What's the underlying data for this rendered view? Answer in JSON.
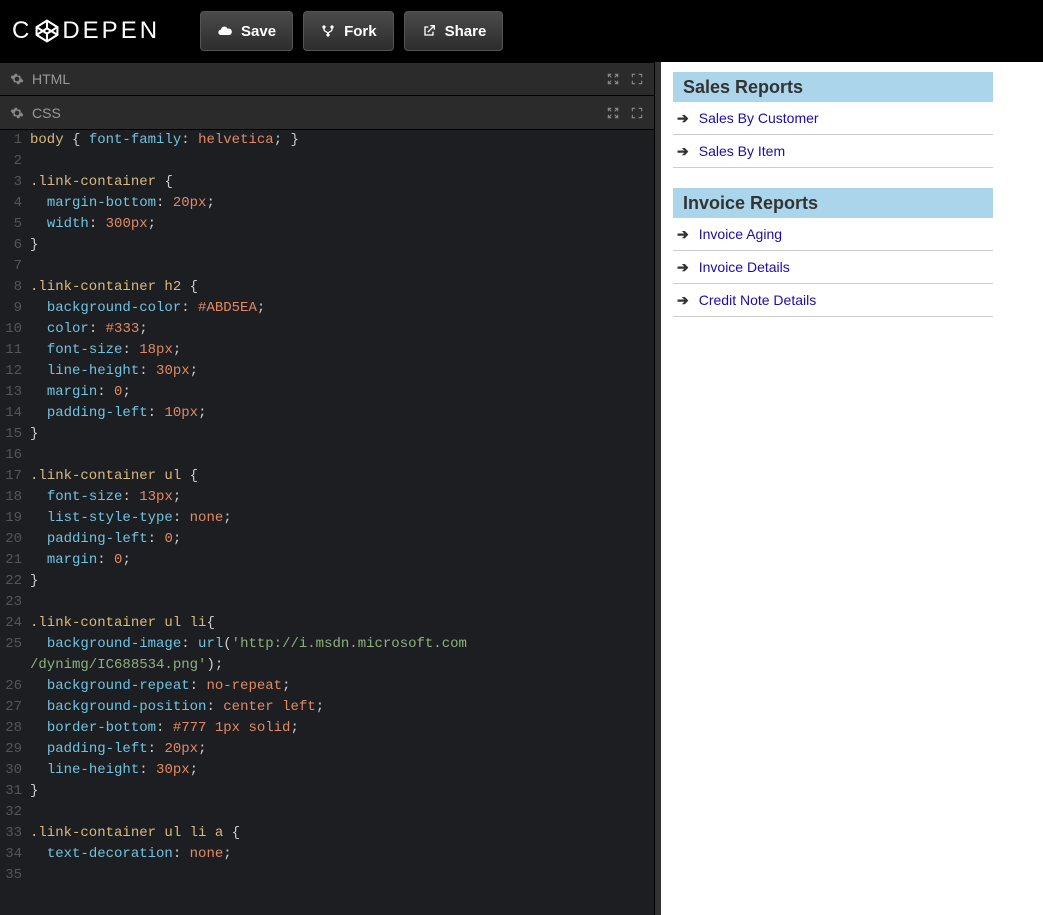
{
  "header": {
    "logo_text_left": "C",
    "logo_text_right": "DEPEN",
    "save_label": "Save",
    "fork_label": "Fork",
    "share_label": "Share"
  },
  "panels": {
    "html_label": "HTML",
    "css_label": "CSS"
  },
  "code_lines": [
    {
      "n": "1",
      "html": "<span class='tok-sel'>body</span> <span class='tok-punc'>{</span> <span class='tok-prop'>font-family</span><span class='tok-punc'>:</span> <span class='tok-val'>helvetica</span><span class='tok-punc'>;</span> <span class='tok-punc'>}</span>"
    },
    {
      "n": "2",
      "html": ""
    },
    {
      "n": "3",
      "html": "<span class='tok-sel'>.link-container</span> <span class='tok-punc'>{</span>"
    },
    {
      "n": "4",
      "html": "  <span class='tok-prop'>margin-bottom</span><span class='tok-punc'>:</span> <span class='tok-num'>20px</span><span class='tok-punc'>;</span>"
    },
    {
      "n": "5",
      "html": "  <span class='tok-prop'>width</span><span class='tok-punc'>:</span> <span class='tok-num'>300px</span><span class='tok-punc'>;</span>"
    },
    {
      "n": "6",
      "html": "<span class='tok-punc'>}</span>"
    },
    {
      "n": "7",
      "html": ""
    },
    {
      "n": "8",
      "html": "<span class='tok-sel'>.link-container h2</span> <span class='tok-punc'>{</span>"
    },
    {
      "n": "9",
      "html": "  <span class='tok-prop'>background-color</span><span class='tok-punc'>:</span> <span class='tok-val'>#ABD5EA</span><span class='tok-punc'>;</span>"
    },
    {
      "n": "10",
      "html": "  <span class='tok-prop'>color</span><span class='tok-punc'>:</span> <span class='tok-val'>#333</span><span class='tok-punc'>;</span>"
    },
    {
      "n": "11",
      "html": "  <span class='tok-prop'>font-size</span><span class='tok-punc'>:</span> <span class='tok-num'>18px</span><span class='tok-punc'>;</span>"
    },
    {
      "n": "12",
      "html": "  <span class='tok-prop'>line-height</span><span class='tok-punc'>:</span> <span class='tok-num'>30px</span><span class='tok-punc'>;</span>"
    },
    {
      "n": "13",
      "html": "  <span class='tok-prop'>margin</span><span class='tok-punc'>:</span> <span class='tok-num'>0</span><span class='tok-punc'>;</span>"
    },
    {
      "n": "14",
      "html": "  <span class='tok-prop'>padding-left</span><span class='tok-punc'>:</span> <span class='tok-num'>10px</span><span class='tok-punc'>;</span>"
    },
    {
      "n": "15",
      "html": "<span class='tok-punc'>}</span>"
    },
    {
      "n": "16",
      "html": ""
    },
    {
      "n": "17",
      "html": "<span class='tok-sel'>.link-container ul</span> <span class='tok-punc'>{</span>"
    },
    {
      "n": "18",
      "html": "  <span class='tok-prop'>font-size</span><span class='tok-punc'>:</span> <span class='tok-num'>13px</span><span class='tok-punc'>;</span>"
    },
    {
      "n": "19",
      "html": "  <span class='tok-prop'>list-style-type</span><span class='tok-punc'>:</span> <span class='tok-val'>none</span><span class='tok-punc'>;</span>"
    },
    {
      "n": "20",
      "html": "  <span class='tok-prop'>padding-left</span><span class='tok-punc'>:</span> <span class='tok-num'>0</span><span class='tok-punc'>;</span>"
    },
    {
      "n": "21",
      "html": "  <span class='tok-prop'>margin</span><span class='tok-punc'>:</span> <span class='tok-num'>0</span><span class='tok-punc'>;</span>"
    },
    {
      "n": "22",
      "html": "<span class='tok-punc'>}</span>"
    },
    {
      "n": "23",
      "html": ""
    },
    {
      "n": "24",
      "html": "<span class='tok-sel'>.link-container ul li</span><span class='tok-punc'>{</span>"
    },
    {
      "n": "25",
      "html": "  <span class='tok-prop'>background-image</span><span class='tok-punc'>:</span> <span class='tok-url'>url</span><span class='tok-punc'>(</span><span class='tok-str'>'http://i.msdn.microsoft.com</span>"
    },
    {
      "n": "",
      "html": "<span class='tok-str'>/dynimg/IC688534.png'</span><span class='tok-punc'>);</span>"
    },
    {
      "n": "26",
      "html": "  <span class='tok-prop'>background-repeat</span><span class='tok-punc'>:</span> <span class='tok-val'>no-repeat</span><span class='tok-punc'>;</span>"
    },
    {
      "n": "27",
      "html": "  <span class='tok-prop'>background-position</span><span class='tok-punc'>:</span> <span class='tok-val'>center left</span><span class='tok-punc'>;</span>"
    },
    {
      "n": "28",
      "html": "  <span class='tok-prop'>border-bottom</span><span class='tok-punc'>:</span> <span class='tok-val'>#777 1px solid</span><span class='tok-punc'>;</span>"
    },
    {
      "n": "29",
      "html": "  <span class='tok-prop'>padding-left</span><span class='tok-punc'>:</span> <span class='tok-num'>20px</span><span class='tok-punc'>;</span>"
    },
    {
      "n": "30",
      "html": "  <span class='tok-prop'>line-height</span><span class='tok-punc'>:</span> <span class='tok-num'>30px</span><span class='tok-punc'>;</span>"
    },
    {
      "n": "31",
      "html": "<span class='tok-punc'>}</span>"
    },
    {
      "n": "32",
      "html": ""
    },
    {
      "n": "33",
      "html": "<span class='tok-sel'>.link-container ul li a</span> <span class='tok-punc'>{</span>"
    },
    {
      "n": "34",
      "html": "  <span class='tok-prop'>text-decoration</span><span class='tok-punc'>:</span> <span class='tok-val'>none</span><span class='tok-punc'>;</span>"
    },
    {
      "n": "35",
      "html": ""
    }
  ],
  "preview": {
    "sections": [
      {
        "title": "Sales Reports",
        "links": [
          "Sales By Customer",
          "Sales By Item"
        ]
      },
      {
        "title": "Invoice Reports",
        "links": [
          "Invoice Aging",
          "Invoice Details",
          "Credit Note Details"
        ]
      }
    ]
  }
}
